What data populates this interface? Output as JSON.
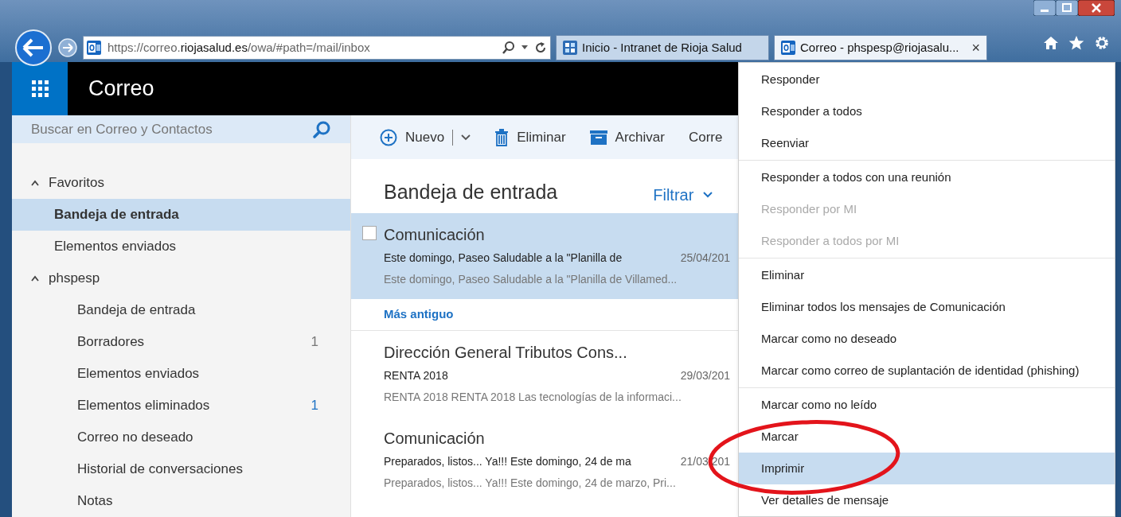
{
  "browser": {
    "address_parts": [
      {
        "text": "https://correo.",
        "emphasis": false
      },
      {
        "text": "riojasalud.es",
        "emphasis": true
      },
      {
        "text": "/owa/#path=/mail/inbox",
        "emphasis": false
      }
    ],
    "tabs": [
      {
        "label": "Inicio - Intranet de Rioja Salud",
        "kind": "intranet",
        "selected": false
      },
      {
        "label": "Correo - phspesp@riojasalu...",
        "kind": "mail",
        "selected": true,
        "close": "×"
      }
    ]
  },
  "app": {
    "title": "Correo"
  },
  "search": {
    "placeholder": "Buscar en Correo y Contactos"
  },
  "toolbar": [
    {
      "label": "Nuevo",
      "kind": "new"
    },
    {
      "label": "Eliminar",
      "kind": "delete"
    },
    {
      "label": "Archivar",
      "kind": "archive"
    },
    {
      "label": "Corre",
      "kind": "plain"
    }
  ],
  "folders": [
    {
      "label": "Favoritos",
      "expanded": true,
      "children": [
        {
          "label": "Bandeja de entrada",
          "selected": true
        },
        {
          "label": "Elementos enviados",
          "selected": false
        }
      ]
    },
    {
      "label": "phspesp",
      "expanded": true,
      "children": [
        {
          "label": "Bandeja de entrada",
          "selected": false
        },
        {
          "label": "Borradores",
          "selected": false,
          "count": "1",
          "unread": false
        },
        {
          "label": "Elementos enviados",
          "selected": false
        },
        {
          "label": "Elementos eliminados",
          "selected": false,
          "count": "1",
          "unread": true
        },
        {
          "label": "Correo no deseado",
          "selected": false
        },
        {
          "label": "Historial de conversaciones",
          "selected": false
        },
        {
          "label": "Notas",
          "selected": false
        }
      ]
    }
  ],
  "message_list": {
    "title": "Bandeja de entrada",
    "filter": "Filtrar",
    "items": [
      {
        "kind": "message",
        "selected": true,
        "sender": "Comunicación",
        "subject": "Este domingo, Paseo Saludable a la \"Planilla de",
        "date": "25/04/201",
        "preview": "Este domingo, Paseo Saludable a la \"Planilla de Villamed..."
      },
      {
        "kind": "group",
        "label": "Más antiguo"
      },
      {
        "kind": "message",
        "selected": false,
        "sender": "Dirección General Tributos Cons...",
        "subject": "RENTA 2018",
        "date": "29/03/201",
        "preview": "RENTA 2018 RENTA 2018 Las tecnologías de la informaci..."
      },
      {
        "kind": "message",
        "selected": false,
        "sender": "Comunicación",
        "subject": "Preparados, listos... Ya!!! Este domingo, 24 de ma",
        "date": "21/03/201",
        "preview": "Preparados, listos... Ya!!! Este domingo, 24 de marzo, Pri..."
      }
    ]
  },
  "context_menu": [
    [
      {
        "label": "Responder",
        "disabled": false,
        "selected": false
      },
      {
        "label": "Responder a todos",
        "disabled": false,
        "selected": false
      },
      {
        "label": "Reenviar",
        "disabled": false,
        "selected": false
      }
    ],
    [
      {
        "label": "Responder a todos con una reunión",
        "disabled": false,
        "selected": false
      },
      {
        "label": "Responder por MI",
        "disabled": true,
        "selected": false
      },
      {
        "label": "Responder a todos por MI",
        "disabled": true,
        "selected": false
      }
    ],
    [
      {
        "label": "Eliminar",
        "disabled": false,
        "selected": false
      },
      {
        "label": "Eliminar todos los mensajes de Comunicación",
        "disabled": false,
        "selected": false
      },
      {
        "label": "Marcar como no deseado",
        "disabled": false,
        "selected": false
      },
      {
        "label": "Marcar como correo de suplantación de identidad (phishing)",
        "disabled": false,
        "selected": false
      }
    ],
    [
      {
        "label": "Marcar como no leído",
        "disabled": false,
        "selected": false
      },
      {
        "label": "Marcar",
        "disabled": false,
        "selected": false
      },
      {
        "label": "Imprimir",
        "disabled": false,
        "selected": true
      },
      {
        "label": "Ver detalles de mensaje",
        "disabled": false,
        "selected": false
      }
    ]
  ]
}
